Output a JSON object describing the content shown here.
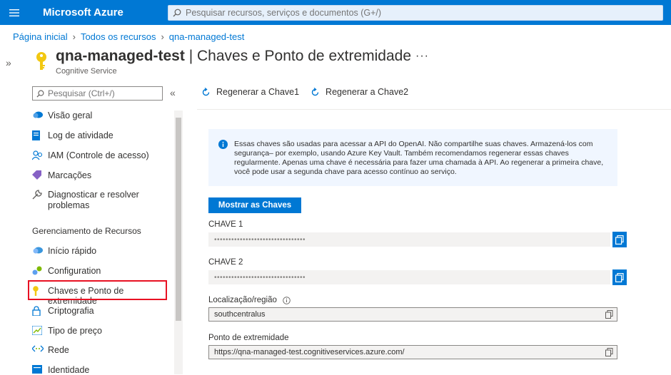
{
  "topbar": {
    "brand": "Microsoft Azure",
    "search_placeholder": "Pesquisar recursos, serviços e documentos (G+/)"
  },
  "breadcrumb": [
    "Página inicial",
    "Todos os recursos",
    "qna-managed-test"
  ],
  "page": {
    "resource_name": "qna-managed-test",
    "separator": " | ",
    "blade_title": "Chaves e Ponto de extremidade",
    "subtitle": "Cognitive Service",
    "more": "···"
  },
  "sidebar": {
    "search_placeholder": "Pesquisar (Ctrl+/)",
    "collapse": "«",
    "items": [
      {
        "label": "Visão geral",
        "icon": "cloud-icon"
      },
      {
        "label": "Log de atividade",
        "icon": "log-icon"
      },
      {
        "label": "IAM (Controle de acesso)",
        "icon": "people-icon"
      },
      {
        "label": "Marcações",
        "icon": "tag-icon"
      },
      {
        "label": "Diagnosticar e resolver problemas",
        "icon": "wrench-icon"
      }
    ],
    "section_title": "Gerenciamento de Recursos",
    "section_items": [
      {
        "label": "Início rápido",
        "icon": "cloud-quickstart-icon"
      },
      {
        "label": "Configuration",
        "icon": "gears-icon"
      },
      {
        "label": "Chaves e Ponto de extremidade",
        "icon": "key-icon"
      },
      {
        "label": "Criptografia",
        "icon": "lock-icon"
      },
      {
        "label": "Tipo de preço",
        "icon": "pricing-icon"
      },
      {
        "label": "Rede",
        "icon": "network-icon"
      },
      {
        "label": "Identidade",
        "icon": "identity-icon"
      }
    ]
  },
  "toolbar": {
    "regen1": "Regenerar a Chave1",
    "regen2": "Regenerar a Chave2"
  },
  "info": {
    "text": "Essas chaves são usadas para acessar a API do OpenAI. Não compartilhe suas chaves. Armazená-los com segurança– por exemplo, usando Azure Key Vault. Também recomendamos regenerar essas chaves regularmente. Apenas uma chave é necessária para fazer uma chamada à API. Ao regenerar a primeira chave, você pode usar a segunda chave para acesso contínuo ao serviço."
  },
  "show_keys_label": "Mostrar as Chaves",
  "fields": {
    "key1_label": "CHAVE 1",
    "key1_value": "••••••••••••••••••••••••••••••••",
    "key2_label": "CHAVE 2",
    "key2_value": "••••••••••••••••••••••••••••••••",
    "location_label": "Localização/região",
    "location_value": "southcentralus",
    "endpoint_label": "Ponto de extremidade",
    "endpoint_value": "https://qna-managed-test.cognitiveservices.azure.com/"
  },
  "colors": {
    "accent": "#0078d4",
    "selection_outline": "#e81123",
    "key_icon": "#f2c811"
  }
}
